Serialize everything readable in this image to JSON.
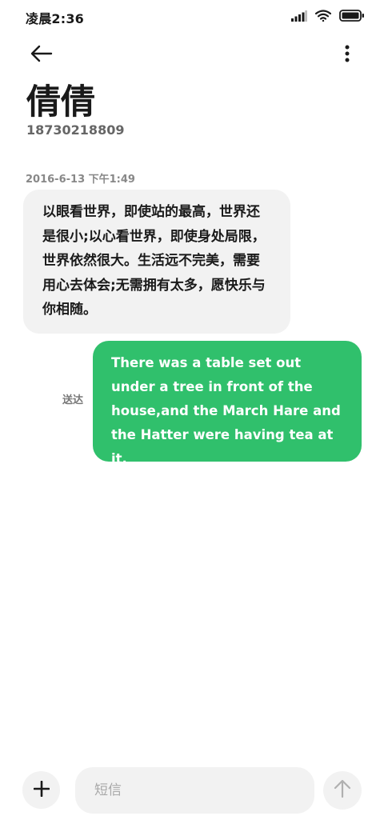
{
  "status_bar": {
    "time": "凌晨2:36",
    "icons": [
      "signal-icon",
      "wifi-icon",
      "battery-icon"
    ]
  },
  "header": {
    "back_icon": "arrow-left-icon",
    "more_icon": "more-vertical-icon",
    "contact_name": "倩倩",
    "contact_number": "18730218809"
  },
  "messages": [
    {
      "direction": "received",
      "timestamp": "2016-6-13 下午1:49",
      "text": "以眼看世界，即使站的最高，世界还是很小;以心看世界，即使身处局限，世界依然很大。生活远不完美，需要用心去体会;无需拥有太多，愿快乐与你相随。"
    },
    {
      "direction": "sent",
      "status": "送达",
      "text": "There was a table set out under a tree in front of the house,and the March Hare and the Hatter were having tea at it."
    }
  ],
  "composer": {
    "add_icon": "plus-icon",
    "placeholder": "短信",
    "value": "",
    "send_icon": "arrow-up-icon"
  },
  "colors": {
    "sent_bubble": "#30c06c",
    "received_bubble": "#f2f2f2",
    "background": "#ffffff"
  }
}
